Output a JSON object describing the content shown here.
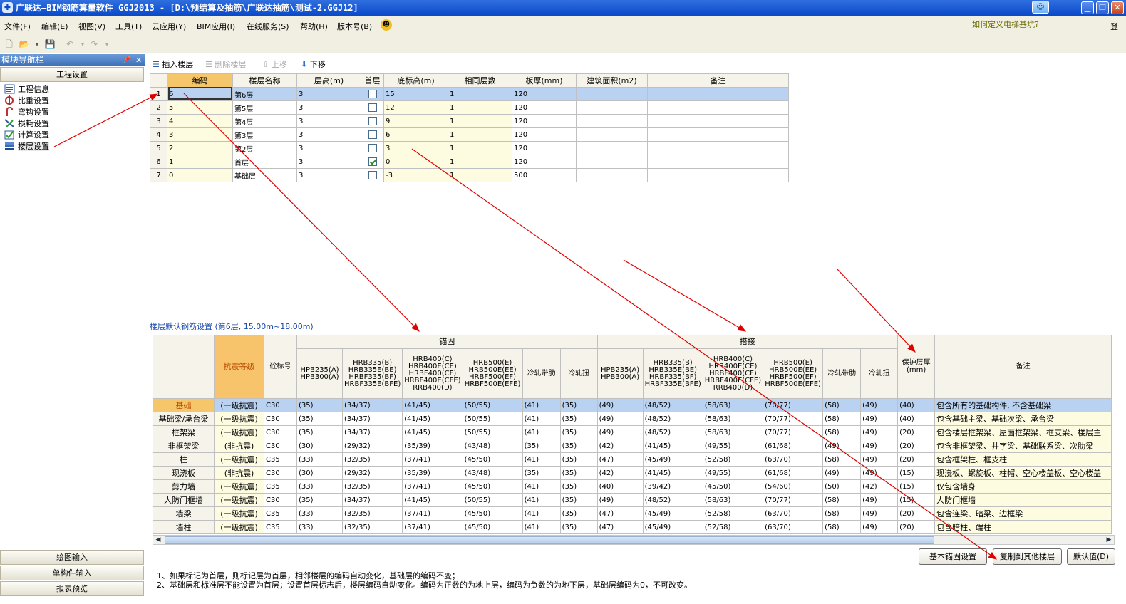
{
  "window": {
    "title": "广联达—BIM钢筋算量软件 GGJ2013 - [D:\\预结算及抽筋\\广联达抽筋\\测试-2.GGJ12]"
  },
  "menu": {
    "items": [
      "文件(F)",
      "编辑(E)",
      "视图(V)",
      "工具(T)",
      "云应用(Y)",
      "BIM应用(I)",
      "在线服务(S)",
      "帮助(H)",
      "版本号(B)"
    ],
    "hint_link": "如何定义电梯基坑?",
    "cut_char": "登"
  },
  "nav_panel": {
    "header": "模块导航栏",
    "top_tab": "工程设置",
    "items": [
      "工程信息",
      "比重设置",
      "弯钩设置",
      "损耗设置",
      "计算设置",
      "楼层设置"
    ],
    "bottom_tabs": [
      "绘图输入",
      "单构件输入",
      "报表预览"
    ]
  },
  "floor_toolbar": {
    "insert": "插入楼层",
    "delete": "删除楼层",
    "up": "上移",
    "down": "下移"
  },
  "floor_table": {
    "headers": [
      "编码",
      "楼层名称",
      "层高(m)",
      "首层",
      "底标高(m)",
      "相同层数",
      "板厚(mm)",
      "建筑面积(m2)",
      "备注"
    ],
    "rows": [
      {
        "n": "1",
        "code": "6",
        "name": "第6层",
        "height": "3",
        "first": false,
        "bottom": "15",
        "same": "1",
        "slab": "120"
      },
      {
        "n": "2",
        "code": "5",
        "name": "第5层",
        "height": "3",
        "first": false,
        "bottom": "12",
        "same": "1",
        "slab": "120"
      },
      {
        "n": "3",
        "code": "4",
        "name": "第4层",
        "height": "3",
        "first": false,
        "bottom": "9",
        "same": "1",
        "slab": "120"
      },
      {
        "n": "4",
        "code": "3",
        "name": "第3层",
        "height": "3",
        "first": false,
        "bottom": "6",
        "same": "1",
        "slab": "120"
      },
      {
        "n": "5",
        "code": "2",
        "name": "第2层",
        "height": "3",
        "first": false,
        "bottom": "3",
        "same": "1",
        "slab": "120"
      },
      {
        "n": "6",
        "code": "1",
        "name": "首层",
        "height": "3",
        "first": true,
        "bottom": "0",
        "same": "1",
        "slab": "120"
      },
      {
        "n": "7",
        "code": "0",
        "name": "基础层",
        "height": "3",
        "first": false,
        "bottom": "-3",
        "same": "1",
        "slab": "500"
      }
    ]
  },
  "rebar_panel": {
    "title": "楼层默认钢筋设置 (第6层, 15.00m~18.00m)",
    "group_anchor": "锚固",
    "group_lap": "搭接",
    "headers": {
      "grade": "抗震等级",
      "concrete": "砼标号",
      "hpb": "HPB235(A) HPB300(A)",
      "hrb335": "HRB335(B) HRB335E(BE) HRBF335(BF) HRBF335E(BFE)",
      "hrb400": "HRB400(C) HRB400E(CE) HRBF400(CF) HRBF400E(CFE) RRB400(D)",
      "hrb500": "HRB500(E) HRB500E(EE) HRBF500(EF) HRBF500E(EFE)",
      "cold_ribbed": "冷轧带肋",
      "cold_twisted": "冷轧扭",
      "cover": "保护层厚(mm)",
      "note": "备注"
    },
    "rows": [
      {
        "cat": "基础",
        "grade": "(一级抗震)",
        "con": "C30",
        "a": [
          "(35)",
          "(34/37)",
          "(41/45)",
          "(50/55)",
          "(41)",
          "(35)"
        ],
        "l": [
          "(49)",
          "(48/52)",
          "(58/63)",
          "(70/77)",
          "(58)",
          "(49)"
        ],
        "cover": "(40)",
        "note": "包含所有的基础构件, 不含基础梁"
      },
      {
        "cat": "基础梁/承台梁",
        "grade": "(一级抗震)",
        "con": "C30",
        "a": [
          "(35)",
          "(34/37)",
          "(41/45)",
          "(50/55)",
          "(41)",
          "(35)"
        ],
        "l": [
          "(49)",
          "(48/52)",
          "(58/63)",
          "(70/77)",
          "(58)",
          "(49)"
        ],
        "cover": "(40)",
        "note": "包含基础主梁、基础次梁、承台梁"
      },
      {
        "cat": "框架梁",
        "grade": "(一级抗震)",
        "con": "C30",
        "a": [
          "(35)",
          "(34/37)",
          "(41/45)",
          "(50/55)",
          "(41)",
          "(35)"
        ],
        "l": [
          "(49)",
          "(48/52)",
          "(58/63)",
          "(70/77)",
          "(58)",
          "(49)"
        ],
        "cover": "(20)",
        "note": "包含楼层框架梁、屋面框架梁、框支梁、楼层主"
      },
      {
        "cat": "非框架梁",
        "grade": "(非抗震)",
        "con": "C30",
        "a": [
          "(30)",
          "(29/32)",
          "(35/39)",
          "(43/48)",
          "(35)",
          "(35)"
        ],
        "l": [
          "(42)",
          "(41/45)",
          "(49/55)",
          "(61/68)",
          "(49)",
          "(49)"
        ],
        "cover": "(20)",
        "note": "包含非框架梁、井字梁、基础联系梁、次肋梁"
      },
      {
        "cat": "柱",
        "grade": "(一级抗震)",
        "con": "C35",
        "a": [
          "(33)",
          "(32/35)",
          "(37/41)",
          "(45/50)",
          "(41)",
          "(35)"
        ],
        "l": [
          "(47)",
          "(45/49)",
          "(52/58)",
          "(63/70)",
          "(58)",
          "(49)"
        ],
        "cover": "(20)",
        "note": "包含框架柱、框支柱"
      },
      {
        "cat": "现浇板",
        "grade": "(非抗震)",
        "con": "C30",
        "a": [
          "(30)",
          "(29/32)",
          "(35/39)",
          "(43/48)",
          "(35)",
          "(35)"
        ],
        "l": [
          "(42)",
          "(41/45)",
          "(49/55)",
          "(61/68)",
          "(49)",
          "(49)"
        ],
        "cover": "(15)",
        "note": "现浇板、螺旋板、柱帽、空心楼盖板、空心楼盖"
      },
      {
        "cat": "剪力墙",
        "grade": "(一级抗震)",
        "con": "C35",
        "a": [
          "(33)",
          "(32/35)",
          "(37/41)",
          "(45/50)",
          "(41)",
          "(35)"
        ],
        "l": [
          "(40)",
          "(39/42)",
          "(45/50)",
          "(54/60)",
          "(50)",
          "(42)"
        ],
        "cover": "(15)",
        "note": "仅包含墙身"
      },
      {
        "cat": "人防门框墙",
        "grade": "(一级抗震)",
        "con": "C30",
        "a": [
          "(35)",
          "(34/37)",
          "(41/45)",
          "(50/55)",
          "(41)",
          "(35)"
        ],
        "l": [
          "(49)",
          "(48/52)",
          "(58/63)",
          "(70/77)",
          "(58)",
          "(49)"
        ],
        "cover": "(15)",
        "note": "人防门框墙"
      },
      {
        "cat": "墙梁",
        "grade": "(一级抗震)",
        "con": "C35",
        "a": [
          "(33)",
          "(32/35)",
          "(37/41)",
          "(45/50)",
          "(41)",
          "(35)"
        ],
        "l": [
          "(47)",
          "(45/49)",
          "(52/58)",
          "(63/70)",
          "(58)",
          "(49)"
        ],
        "cover": "(20)",
        "note": "包含连梁、暗梁、边框梁"
      },
      {
        "cat": "墙柱",
        "grade": "(一级抗震)",
        "con": "C35",
        "a": [
          "(33)",
          "(32/35)",
          "(37/41)",
          "(45/50)",
          "(41)",
          "(35)"
        ],
        "l": [
          "(47)",
          "(45/49)",
          "(52/58)",
          "(63/70)",
          "(58)",
          "(49)"
        ],
        "cover": "(20)",
        "note": "包含暗柱、端柱"
      }
    ]
  },
  "actions": {
    "anchor_settings": "基本锚固设置",
    "copy_floors": "复制到其他楼层",
    "defaults": "默认值(D)"
  },
  "notes": [
    "1、如果标记为首层，则标记层为首层，相邻楼层的编码自动变化，基础层的编码不变；",
    "2、基础层和标准层不能设置为首层；设置首层标志后，楼层编码自动变化。编码为正数的为地上层，编码为负数的为地下层，基础层编码为0，不可改变。"
  ],
  "colors": {
    "title_bar": "#0a49c8",
    "selected_row": "#b9d2f1",
    "header_highlight": "#f5c76a",
    "editable_cell": "#fefce0",
    "annotation_arrow": "#e00000"
  }
}
